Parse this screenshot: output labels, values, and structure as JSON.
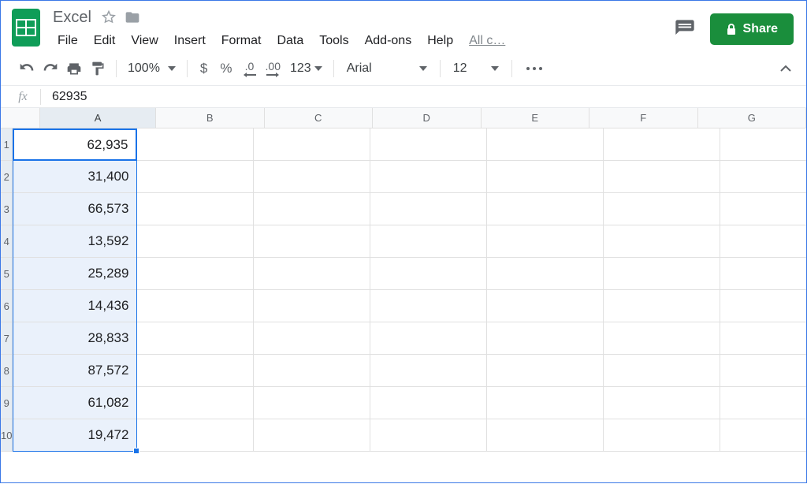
{
  "header": {
    "doc_title": "Excel",
    "menus": [
      "File",
      "Edit",
      "View",
      "Insert",
      "Format",
      "Data",
      "Tools",
      "Add-ons",
      "Help"
    ],
    "last_edit": "All c…",
    "share_label": "Share"
  },
  "toolbar": {
    "zoom": "100%",
    "currency": "$",
    "percent": "%",
    "dec_less": ".0",
    "dec_more": ".00",
    "num_fmt": "123",
    "font": "Arial",
    "font_size": "12"
  },
  "formula_bar": {
    "fx_label": "fx",
    "value": "62935"
  },
  "grid": {
    "columns": [
      "A",
      "B",
      "C",
      "D",
      "E",
      "F",
      "G"
    ],
    "row_count": 10,
    "selected_column": "A",
    "selected_rows": [
      1,
      10
    ],
    "active_cell": "A1",
    "values_A": [
      "62,935",
      "31,400",
      "66,573",
      "13,592",
      "25,289",
      "14,436",
      "28,833",
      "87,572",
      "61,082",
      "19,472"
    ]
  }
}
